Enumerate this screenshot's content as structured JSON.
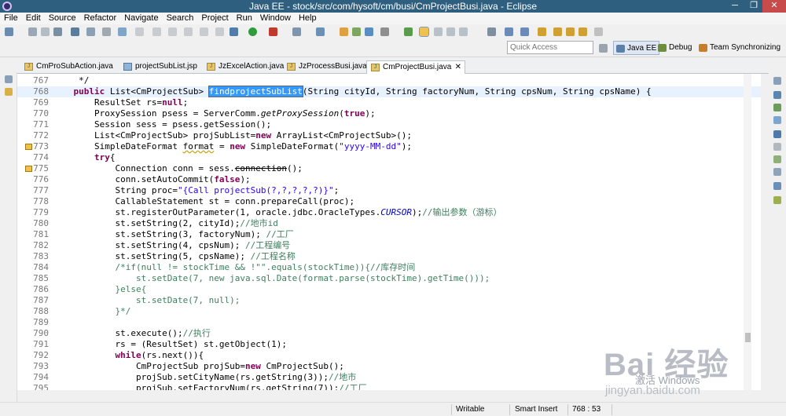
{
  "window": {
    "title": "Java EE - stock/src/com/hysoft/cm/busi/CmProjectBusi.java - Eclipse",
    "minimize": "─",
    "maximize": "❐",
    "close": "✕"
  },
  "menu": [
    "File",
    "Edit",
    "Source",
    "Refactor",
    "Navigate",
    "Search",
    "Project",
    "Run",
    "Window",
    "Help"
  ],
  "quick_access": {
    "placeholder": "Quick Access"
  },
  "perspectives": [
    {
      "label": "Java EE",
      "active": true
    },
    {
      "label": "Debug",
      "active": false
    },
    {
      "label": "Team Synchronizing",
      "active": false
    }
  ],
  "editor_tabs": [
    {
      "label": "CmProSubAction.java",
      "icon": "java-file-icon",
      "active": false
    },
    {
      "label": "projectSubList.jsp",
      "icon": "jsp-file-icon",
      "active": false
    },
    {
      "label": "JzExcelAction.java",
      "icon": "java-file-icon",
      "active": false
    },
    {
      "label": "JzProcessBusi.java",
      "icon": "java-file-icon",
      "active": false
    },
    {
      "label": "CmProjectBusi.java",
      "icon": "java-file-icon",
      "active": true
    }
  ],
  "code": {
    "l767": {
      "n": "767",
      "a": "     */"
    },
    "l768": {
      "n": "768",
      "a": "    ",
      "kw": "public",
      "b": " List<CmProjectSub> ",
      "sel": "findprojectSubList",
      "c": "(String cityId, String factoryNum, String cpsNum, String cpsName) {"
    },
    "l769": {
      "n": "769",
      "a": "        ResultSet rs=",
      "kw": "null",
      "b": ";"
    },
    "l770": {
      "n": "770",
      "a": "        ProxySession psess = ServerComm.",
      "it": "getProxySession",
      "b": "(",
      "kw": "true",
      "c": ");"
    },
    "l771": {
      "n": "771",
      "a": "        Session sess = psess.getSession();"
    },
    "l772": {
      "n": "772",
      "a": "        List<CmProjectSub> projSubList=",
      "kw": "new",
      "b": " ArrayList<CmProjectSub>();"
    },
    "l773": {
      "n": "773",
      "a": "        SimpleDateFormat ",
      "warn": "format",
      "b": " = ",
      "kw": "new",
      "c": " SimpleDateFormat(",
      "str": "\"yyyy-MM-dd\"",
      "d": ");"
    },
    "l774": {
      "n": "774",
      "a": "        ",
      "kw": "try",
      "b": "{"
    },
    "l775": {
      "n": "775",
      "a": "            Connection conn = sess.",
      "strike": "connection",
      "b": "();"
    },
    "l776": {
      "n": "776",
      "a": "            conn.setAutoCommit(",
      "kw": "false",
      "b": ");"
    },
    "l777": {
      "n": "777",
      "a": "            String proc=",
      "str": "\"{Call projectSub(?,?,?,?,?)}\"",
      "b": ";"
    },
    "l778": {
      "n": "778",
      "a": "            CallableStatement st = conn.prepareCall(proc);"
    },
    "l779": {
      "n": "779",
      "a": "            st.registerOutParameter(1, oracle.jdbc.OracleTypes.",
      "cst": "CURSOR",
      "b": ");",
      "cm": "//输出参数（游标）"
    },
    "l780": {
      "n": "780",
      "a": "            st.setString(2, cityId);",
      "cm": "//地市id"
    },
    "l781": {
      "n": "781",
      "a": "            st.setString(3, factoryNum); ",
      "cm": "//工厂"
    },
    "l782": {
      "n": "782",
      "a": "            st.setString(4, cpsNum); ",
      "cm": "//工程编号"
    },
    "l783": {
      "n": "783",
      "a": "            st.setString(5, cpsName); ",
      "cm": "//工程名称"
    },
    "l784": {
      "n": "784",
      "a": "            ",
      "cm": "/*if(null != stockTime && !\"\".equals(stockTime)){//库存时间"
    },
    "l785": {
      "n": "785",
      "a": "",
      "cm": "                st.setDate(7, new java.sql.Date(format.parse(stockTime).getTime()));"
    },
    "l786": {
      "n": "786",
      "a": "",
      "cm": "            }else{"
    },
    "l787": {
      "n": "787",
      "a": "",
      "cm": "                st.setDate(7, null);"
    },
    "l788": {
      "n": "788",
      "a": "",
      "cm": "            }*/"
    },
    "l789": {
      "n": "789",
      "a": ""
    },
    "l790": {
      "n": "790",
      "a": "            st.execute();",
      "cm": "//执行"
    },
    "l791": {
      "n": "791",
      "a": "            rs = (ResultSet) st.getObject(1);"
    },
    "l792": {
      "n": "792",
      "a": "            ",
      "kw": "while",
      "b": "(rs.next()){"
    },
    "l793": {
      "n": "793",
      "a": "                CmProjectSub projSub=",
      "kw": "new",
      "b": " CmProjectSub();"
    },
    "l794": {
      "n": "794",
      "a": "                projSub.setCityName(rs.getString(3));",
      "cm": "//地市"
    },
    "l795": {
      "n": "795",
      "a": "                projSub.setFactoryNum(rs.getString(7));",
      "cm": "//工厂"
    }
  },
  "status": {
    "writable": "Writable",
    "insert_mode": "Smart Insert",
    "position": "768 : 53"
  },
  "watermark": {
    "brand": "Bai  经验",
    "activate": "激活 Windows",
    "url": "jingyan.baidu.com"
  }
}
